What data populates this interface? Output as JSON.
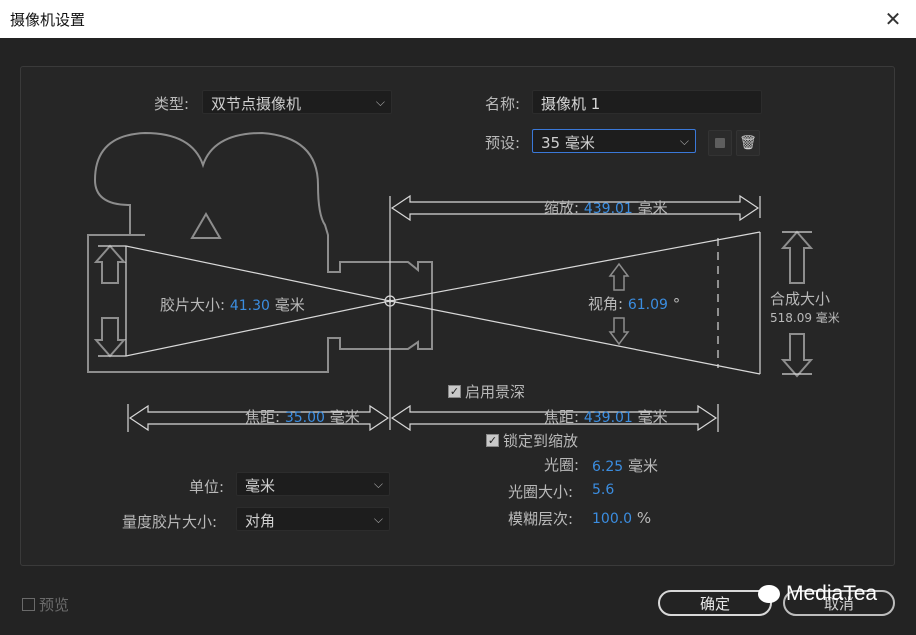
{
  "window": {
    "title": "摄像机设置"
  },
  "type": {
    "label": "类型:",
    "value": "双节点摄像机"
  },
  "name": {
    "label": "名称:",
    "value": "摄像机 1"
  },
  "preset": {
    "label": "预设:",
    "value": "35 毫米"
  },
  "diagram": {
    "zoom_label": "缩放:",
    "zoom_value": "439.01",
    "zoom_unit": "毫米",
    "film_label": "胶片大小:",
    "film_value": "41.30",
    "film_unit": "毫米",
    "angle_label": "视角:",
    "angle_value": "61.09",
    "angle_unit": "°",
    "comp_label": "合成大小",
    "comp_value": "518.09 毫米",
    "focal_left_label": "焦距:",
    "focal_left_value": "35.00",
    "focal_left_unit": "毫米",
    "focal_right_label": "焦距:",
    "focal_right_value": "439.01",
    "focal_right_unit": "毫米"
  },
  "enable_dof": {
    "label": "启用景深",
    "checked": true
  },
  "lock_zoom": {
    "label": "锁定到缩放",
    "checked": true
  },
  "aperture": {
    "label": "光圈:",
    "value": "6.25",
    "unit": "毫米"
  },
  "fstop": {
    "label": "光圈大小:",
    "value": "5.6"
  },
  "blur": {
    "label": "模糊层次:",
    "value": "100.0",
    "unit": "%"
  },
  "units": {
    "label": "单位:",
    "value": "毫米"
  },
  "measure_film": {
    "label": "量度胶片大小:",
    "value": "对角"
  },
  "preview": {
    "label": "预览",
    "checked": false
  },
  "buttons": {
    "ok": "确定",
    "cancel": "取消"
  },
  "watermark": "MediaTea"
}
